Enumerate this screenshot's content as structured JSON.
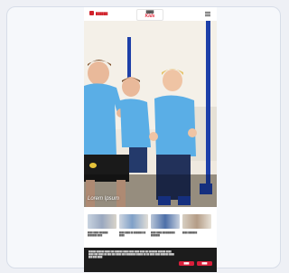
{
  "header": {
    "brand_text": "██████",
    "logo_top": "████",
    "logo_main": "Kids"
  },
  "hero": {
    "caption": "Lorem Ipsum"
  },
  "tiles": [
    {
      "text": "████ ████ ███████ ███████ ████"
    },
    {
      "text": "████ ████ ██ ███████ ██ ████"
    },
    {
      "text": "████ ████ ██████████ ███████"
    },
    {
      "text": "████ ███████"
    }
  ],
  "cookie": {
    "text": "██████ ██████ ████ ███ ██████ ████ ████ ████ ████ ██ ███████ ██████ ████ ████ ███ ████ ██ ███ ███ ████ ███ ████████ █████ ██ ██ ████ ████ ██████ ████ ███ ███ ████",
    "accept_label": "████",
    "settings_label": "████",
    "button_color": "#d91f3b"
  },
  "colors": {
    "accent": "#e0283a",
    "shirt": "#5aaee6",
    "pole": "#1d3fa8",
    "wall": "#f1ece2"
  }
}
